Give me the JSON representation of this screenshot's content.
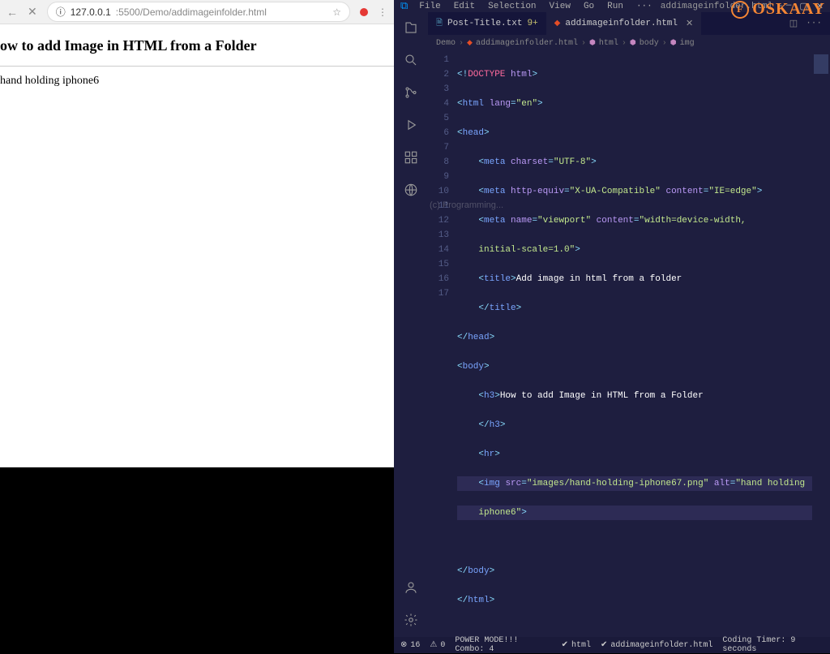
{
  "browser": {
    "url_host": "127.0.0.1",
    "url_port_path": ":5500/Demo/addimageinfolder.html",
    "heading": "ow to add Image in HTML from a Folder",
    "alt_text": "hand holding iphone6"
  },
  "logo": {
    "text": "OSKAAY"
  },
  "titlebar": {
    "menus": [
      "File",
      "Edit",
      "Selection",
      "View",
      "Go",
      "Run",
      "···"
    ],
    "title": "addimageinfolder.html - HTML - Visual ..."
  },
  "tabs": {
    "t1_label": "Post-Title.txt",
    "t1_badge": "9+",
    "t2_label": "addimageinfolder.html"
  },
  "breadcrumb": {
    "b1": "Demo",
    "b2": "addimageinfolder.html",
    "b3": "html",
    "b4": "body",
    "b5": "img"
  },
  "gutter": {
    "l1": "1",
    "l2": "2",
    "l3": "3",
    "l4": "4",
    "l5": "5",
    "l6": "6",
    "l7": "7",
    "l8": "8",
    "l9": "9",
    "l10": "10",
    "l11": "11",
    "l12": "12",
    "l13": "13",
    "l14": "14",
    "l15": "15",
    "l16": "16",
    "l17": "17"
  },
  "code": {
    "doctype": "<!DOCTYPE html>",
    "html_open_tag": "html",
    "lang_attr": "lang",
    "lang_val": "\"en\"",
    "head_tag": "head",
    "meta_tag": "meta",
    "charset_attr": "charset",
    "charset_val": "\"UTF-8\"",
    "httpequiv_attr": "http-equiv",
    "httpequiv_val": "\"X-UA-Compatible\"",
    "content_attr": "content",
    "content_val1": "\"IE=edge\"",
    "name_attr": "name",
    "name_val": "\"viewport\"",
    "content_val2": "\"width=device-width, ",
    "content_val2b": "initial-scale=1.0\"",
    "title_tag": "title",
    "title_text": "Add image in html from a folder",
    "body_tag": "body",
    "h3_tag": "h3",
    "h3_text": "How to add Image in HTML from a Folder",
    "hr_tag": "hr",
    "img_tag": "img",
    "src_attr": "src",
    "src_val": "\"images/hand-holding-iphone67.png\"",
    "alt_attr": "alt",
    "alt_val": "\"hand holding ",
    "alt_val2": "iphone6\""
  },
  "watermark": "(c) Programming...",
  "statusbar": {
    "errors": "16",
    "warnings": "0",
    "power": "POWER MODE!!! Combo: 4",
    "lang": "html",
    "file": "addimageinfolder.html",
    "timer": "Coding Timer: 9 seconds"
  }
}
